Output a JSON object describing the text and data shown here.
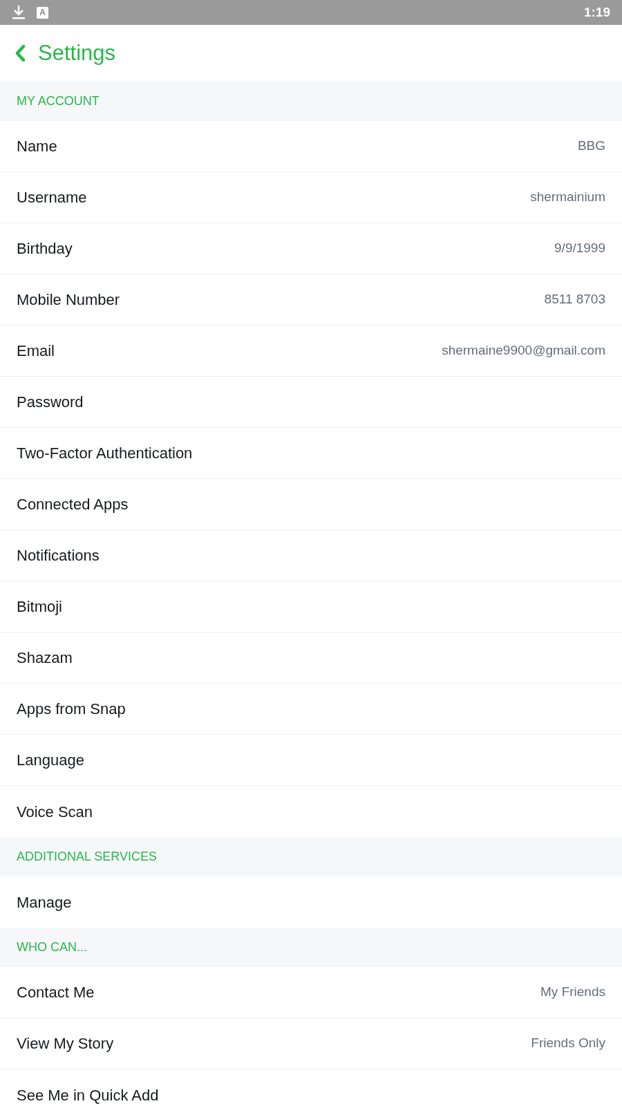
{
  "status_bar": {
    "letter_badge": "A",
    "time": "1:19"
  },
  "header": {
    "title": "Settings"
  },
  "sections": [
    {
      "title": "MY ACCOUNT",
      "rows": [
        {
          "label": "Name",
          "value": "BBG"
        },
        {
          "label": "Username",
          "value": "shermainium"
        },
        {
          "label": "Birthday",
          "value": "9/9/1999"
        },
        {
          "label": "Mobile Number",
          "value": "8511 8703"
        },
        {
          "label": "Email",
          "value": "shermaine9900@gmail.com"
        },
        {
          "label": "Password"
        },
        {
          "label": "Two-Factor Authentication"
        },
        {
          "label": "Connected Apps"
        },
        {
          "label": "Notifications"
        },
        {
          "label": "Bitmoji"
        },
        {
          "label": "Shazam"
        },
        {
          "label": "Apps from Snap"
        },
        {
          "label": "Language"
        },
        {
          "label": "Voice Scan"
        }
      ]
    },
    {
      "title": "ADDITIONAL SERVICES",
      "rows": [
        {
          "label": "Manage"
        }
      ]
    },
    {
      "title": "WHO CAN...",
      "rows": [
        {
          "label": "Contact Me",
          "value": "My Friends"
        },
        {
          "label": "View My Story",
          "value": "Friends Only"
        },
        {
          "label": "See Me in Quick Add"
        }
      ]
    }
  ]
}
